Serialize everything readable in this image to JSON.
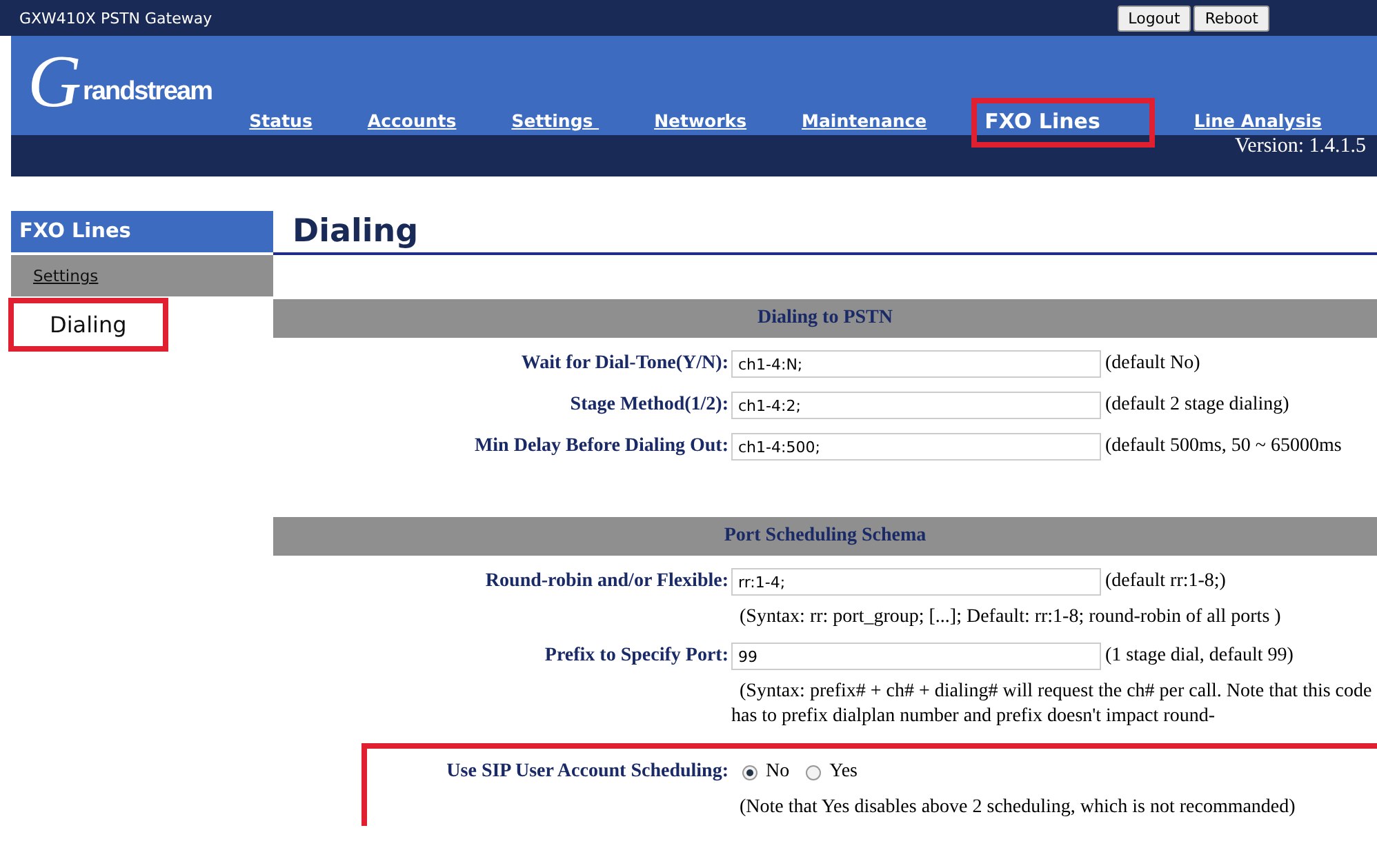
{
  "window": {
    "title": "GXW410X PSTN Gateway"
  },
  "top_buttons": [
    "Logout",
    "Reboot"
  ],
  "logo": {
    "initial": "G",
    "rest": "randstream"
  },
  "nav": [
    {
      "label": "Status",
      "selected": false
    },
    {
      "label": "Accounts",
      "selected": false
    },
    {
      "label": "Settings ",
      "selected": false
    },
    {
      "label": "Networks",
      "selected": false
    },
    {
      "label": "Maintenance",
      "selected": false
    },
    {
      "label": "FXO Lines",
      "selected": true,
      "highlighted": true
    },
    {
      "label": "Line Analysis",
      "selected": false
    }
  ],
  "version": "Version: 1.4.1.5",
  "sidebar": {
    "title": "FXO Lines",
    "items": [
      {
        "label": "Settings",
        "selected": false
      },
      {
        "label": "Dialing",
        "selected": true,
        "highlighted": true
      }
    ]
  },
  "page_title": "Dialing",
  "sections": [
    {
      "title": "Dialing to PSTN",
      "rows": [
        {
          "kind": "input",
          "label": "Wait for Dial-Tone(Y/N):",
          "value": "ch1-4:N;",
          "hint": "(default No)"
        },
        {
          "kind": "input",
          "label": "Stage Method(1/2):",
          "value": "ch1-4:2;",
          "hint": "(default 2 stage dialing)"
        },
        {
          "kind": "input",
          "label": "Min Delay Before Dialing Out:",
          "value": "ch1-4:500;",
          "hint": "(default 500ms, 50 ~ 65000ms"
        }
      ]
    },
    {
      "title": "Port Scheduling Schema",
      "rows": [
        {
          "kind": "input",
          "label": "Round-robin and/or Flexible:",
          "value": "rr:1-4;",
          "hint": "(default rr:1-8;)"
        },
        {
          "kind": "note",
          "text": "(Syntax: rr: port_group; [...]; Default: rr:1-8; round-robin of all ports )"
        },
        {
          "kind": "input",
          "label": "Prefix to Specify Port:",
          "value": "99",
          "hint": "(1 stage dial, default 99)"
        },
        {
          "kind": "note",
          "text": "(Syntax: prefix# + ch# + dialing# will request the ch# per call. Note that this code has to prefix dialplan number and prefix doesn't impact round-"
        },
        {
          "kind": "radio",
          "label": "Use SIP User Account Scheduling:",
          "options": [
            {
              "label": "No",
              "selected": true
            },
            {
              "label": "Yes",
              "selected": false
            }
          ],
          "highlighted": true
        },
        {
          "kind": "note",
          "text": "(Note that Yes disables above 2 scheduling, which is not recommanded)",
          "highlighted": true
        }
      ]
    }
  ]
}
